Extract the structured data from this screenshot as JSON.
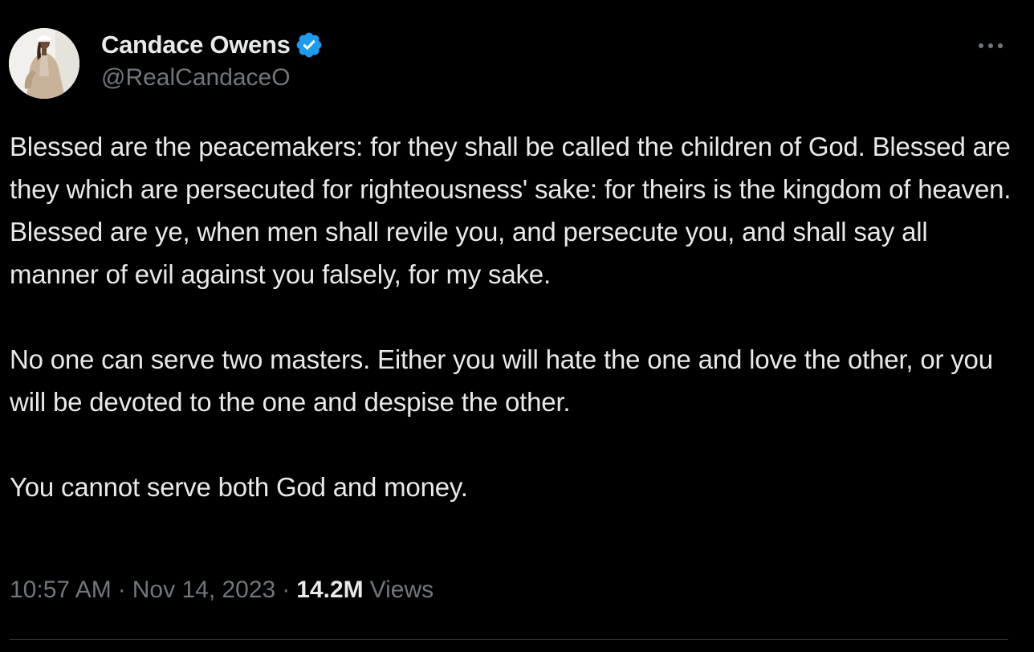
{
  "author": {
    "display_name": "Candace Owens",
    "handle": "@RealCandaceO",
    "verified": true,
    "verified_color": "#1d9bf0",
    "avatar_icon": "profile-photo"
  },
  "menu": {
    "more_icon": "ellipsis-icon"
  },
  "tweet": {
    "paragraphs": [
      "Blessed are the peacemakers: for they shall be called the children of God. Blessed are they which are persecuted for righteousness' sake: for theirs is the kingdom of heaven. Blessed are ye, when men shall revile you, and persecute you, and shall say all manner of evil against you falsely, for my sake.",
      "No one can serve two masters. Either you will hate the one and love the other, or you will be devoted to the one and despise the other.",
      "You cannot serve both God and money."
    ]
  },
  "meta": {
    "time": "10:57 AM",
    "separator": "·",
    "date": "Nov 14, 2023",
    "views_count": "14.2M",
    "views_label": "Views"
  },
  "colors": {
    "background": "#000000",
    "text_primary": "#e7e9ea",
    "text_secondary": "#71767b",
    "divider": "#2f3336"
  }
}
